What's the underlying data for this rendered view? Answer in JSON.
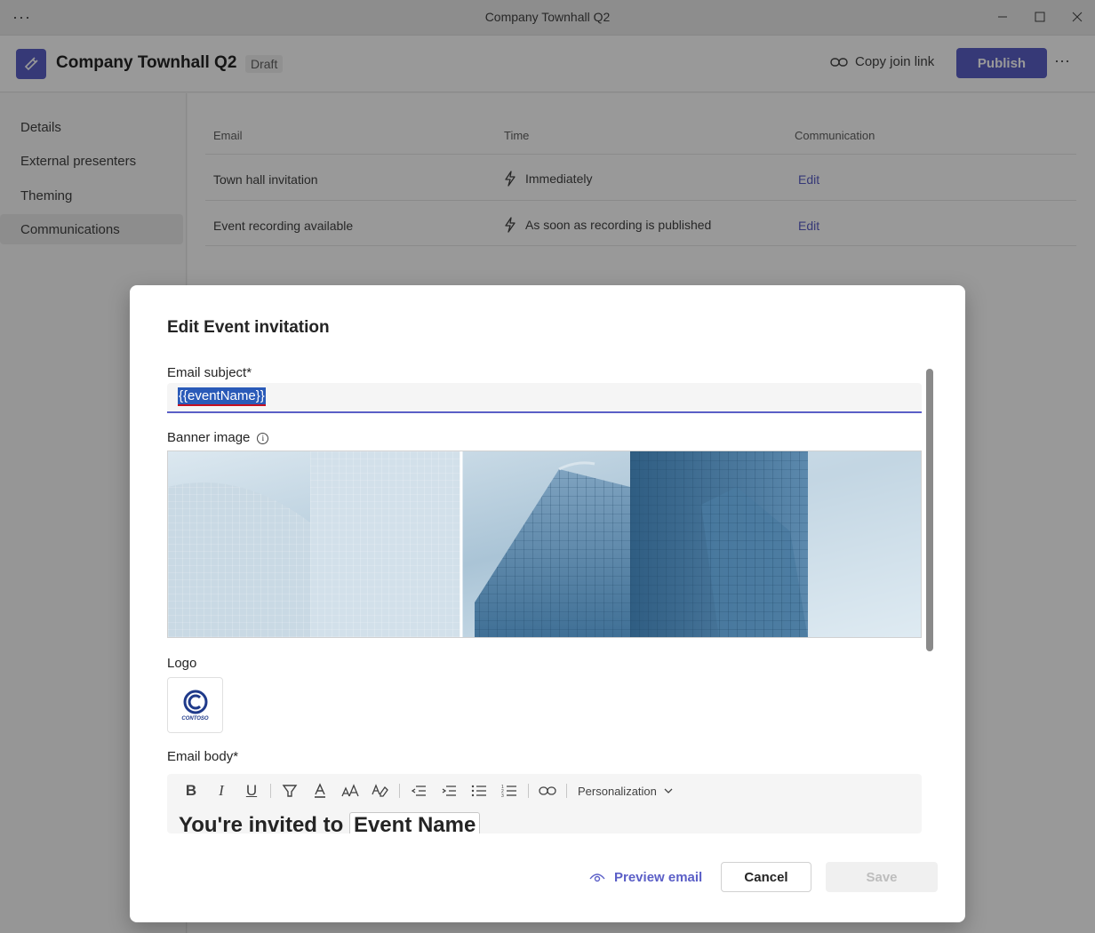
{
  "window": {
    "title": "Company Townhall Q2",
    "menu_icon": "more-horizontal-icon"
  },
  "header": {
    "event_title": "Company Townhall Q2",
    "status_badge": "Draft",
    "copy_link_label": "Copy join link",
    "publish_label": "Publish",
    "accent_color": "#5b5fc7"
  },
  "sidebar": {
    "items": [
      {
        "label": "Details"
      },
      {
        "label": "External presenters"
      },
      {
        "label": "Theming"
      },
      {
        "label": "Communications",
        "active": true
      }
    ]
  },
  "table": {
    "columns": [
      "Email",
      "Time",
      "Communication"
    ],
    "rows": [
      {
        "email": "Town hall invitation",
        "time": "Immediately",
        "action": "Edit"
      },
      {
        "email": "Event recording available",
        "time": "As soon as recording is published",
        "action": "Edit"
      }
    ]
  },
  "dialog": {
    "title": "Edit Event invitation",
    "subject_label": "Email subject*",
    "subject_value": "{{eventName}}",
    "banner_label": "Banner image",
    "logo_label": "Logo",
    "logo_text": "CONTOSO",
    "body_label": "Email body*",
    "personalization_label": "Personalization",
    "body_text_start": "You're invited to",
    "body_text_chip": "Event Name",
    "preview_label": "Preview email",
    "cancel_label": "Cancel",
    "save_label": "Save"
  }
}
